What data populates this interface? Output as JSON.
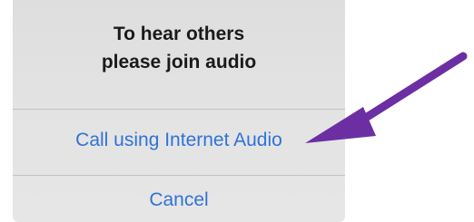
{
  "dialog": {
    "prompt_line1": "To hear others",
    "prompt_line2": "please join audio",
    "call_internet_audio_label": "Call using Internet Audio",
    "cancel_label": "Cancel"
  },
  "colors": {
    "action_blue": "#2f73d6",
    "arrow_purple": "#6b2fa3",
    "sheet_gray": "#e1e1e1"
  },
  "annotation": {
    "icon": "arrow-icon"
  }
}
